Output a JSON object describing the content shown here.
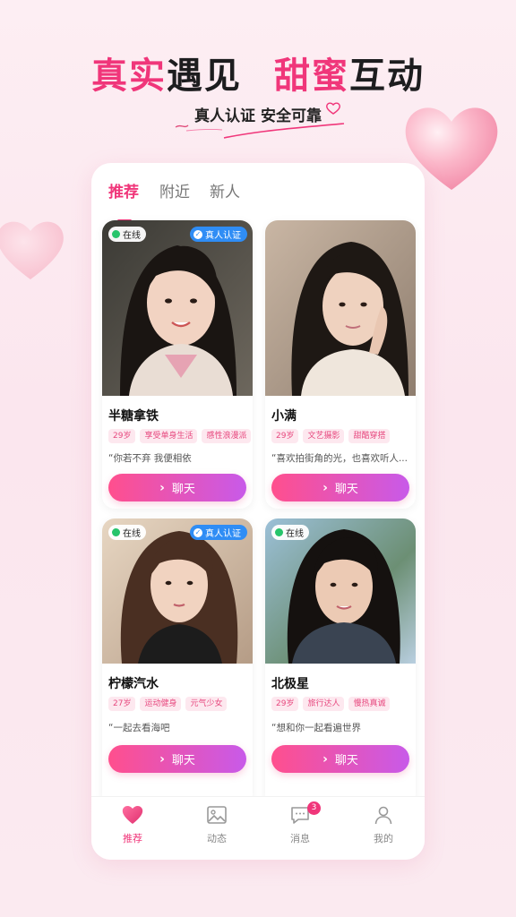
{
  "header": {
    "headline_part1": "真实",
    "headline_part2": "遇见",
    "headline_part3": "甜蜜",
    "headline_part4": "互动",
    "subline": "真人认证 安全可靠"
  },
  "tabs": [
    {
      "label": "推荐",
      "active": true
    },
    {
      "label": "附近",
      "active": false
    },
    {
      "label": "新人",
      "active": false
    }
  ],
  "profiles": [
    {
      "name": "半糖拿铁",
      "online_label": "在线",
      "verified_label": "真人认证",
      "tags": [
        "29岁",
        "享受单身生活",
        "感性浪漫派"
      ],
      "quote": "“你若不弃 我便相依",
      "chat_label": "聊天"
    },
    {
      "name": "小满",
      "tags": [
        "29岁",
        "文艺摄影",
        "甜酷穿搭"
      ],
      "quote": "“喜欢拍街角的光，也喜欢听人...",
      "chat_label": "聊天"
    },
    {
      "name": "柠檬汽水",
      "online_label": "在线",
      "verified_label": "真人认证",
      "tags": [
        "27岁",
        "运动健身",
        "元气少女"
      ],
      "quote": "“一起去看海吧",
      "chat_label": "聊天"
    },
    {
      "name": "北极星",
      "online_label": "在线",
      "tags": [
        "29岁",
        "旅行达人",
        "慢热真诚"
      ],
      "quote": "“想和你一起看遍世界",
      "chat_label": "聊天"
    }
  ],
  "bottom_nav": [
    {
      "label": "推荐",
      "icon": "heart-icon",
      "active": true
    },
    {
      "label": "动态",
      "icon": "image-icon",
      "active": false
    },
    {
      "label": "消息",
      "icon": "message-icon",
      "active": false,
      "badge": "3"
    },
    {
      "label": "我的",
      "icon": "user-icon",
      "active": false
    }
  ],
  "colors": {
    "accent": "#f0367a",
    "button_start": "#ff4f8d",
    "button_end": "#c85ae9",
    "online": "#27c46b",
    "verified": "#2f8df5"
  }
}
